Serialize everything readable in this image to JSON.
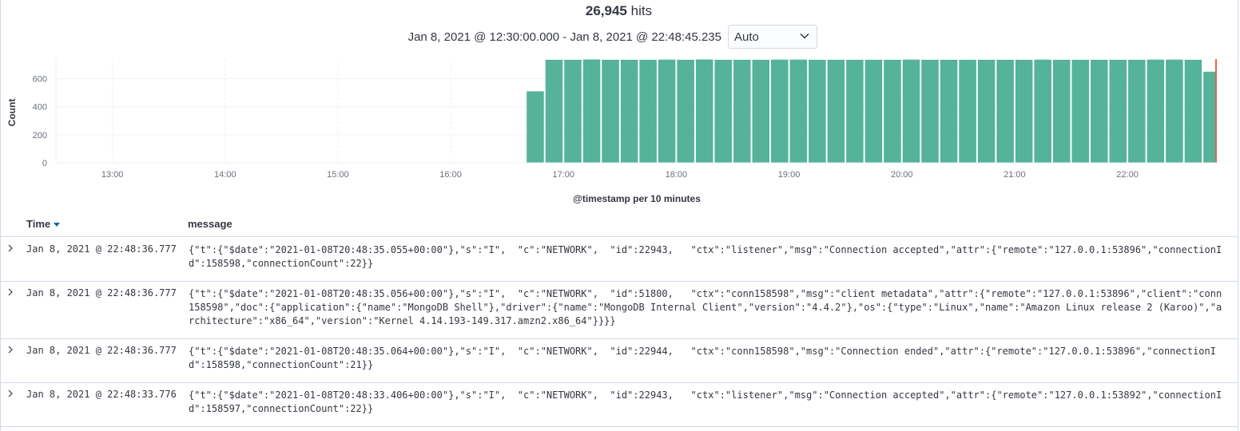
{
  "summary": {
    "hits_count": "26,945",
    "hits_label": "hits"
  },
  "time_range": {
    "text": "Jan 8, 2021 @ 12:30:00.000 - Jan 8, 2021 @ 22:48:45.235"
  },
  "interval": {
    "selected": "Auto"
  },
  "chart_data": {
    "type": "bar",
    "ylabel": "Count",
    "xlabel": "@timestamp per 10 minutes",
    "ylim": [
      0,
      740
    ],
    "yticks": [
      0,
      200,
      400,
      600
    ],
    "xticks": [
      "13:00",
      "14:00",
      "15:00",
      "16:00",
      "17:00",
      "18:00",
      "19:00",
      "20:00",
      "21:00",
      "22:00"
    ],
    "x_start": "12:30",
    "x_end": "22:48",
    "bars": [
      {
        "start": "16:40",
        "value": 510
      },
      {
        "start": "16:50",
        "value": 735
      },
      {
        "start": "17:00",
        "value": 735
      },
      {
        "start": "17:10",
        "value": 737
      },
      {
        "start": "17:20",
        "value": 735
      },
      {
        "start": "17:30",
        "value": 735
      },
      {
        "start": "17:40",
        "value": 735
      },
      {
        "start": "17:50",
        "value": 736
      },
      {
        "start": "18:00",
        "value": 735
      },
      {
        "start": "18:10",
        "value": 737
      },
      {
        "start": "18:20",
        "value": 735
      },
      {
        "start": "18:30",
        "value": 735
      },
      {
        "start": "18:40",
        "value": 735
      },
      {
        "start": "18:50",
        "value": 736
      },
      {
        "start": "19:00",
        "value": 736
      },
      {
        "start": "19:10",
        "value": 735
      },
      {
        "start": "19:20",
        "value": 735
      },
      {
        "start": "19:30",
        "value": 735
      },
      {
        "start": "19:40",
        "value": 735
      },
      {
        "start": "19:50",
        "value": 735
      },
      {
        "start": "20:00",
        "value": 736
      },
      {
        "start": "20:10",
        "value": 735
      },
      {
        "start": "20:20",
        "value": 735
      },
      {
        "start": "20:30",
        "value": 735
      },
      {
        "start": "20:40",
        "value": 735
      },
      {
        "start": "20:50",
        "value": 735
      },
      {
        "start": "21:00",
        "value": 735
      },
      {
        "start": "21:10",
        "value": 736
      },
      {
        "start": "21:20",
        "value": 735
      },
      {
        "start": "21:30",
        "value": 735
      },
      {
        "start": "21:40",
        "value": 735
      },
      {
        "start": "21:50",
        "value": 735
      },
      {
        "start": "22:00",
        "value": 735
      },
      {
        "start": "22:10",
        "value": 736
      },
      {
        "start": "22:20",
        "value": 736
      },
      {
        "start": "22:30",
        "value": 735
      },
      {
        "start": "22:40",
        "value": 650
      }
    ],
    "bar_color": "#54b399",
    "now_marker_color": "#e7664c",
    "grid": true
  },
  "table": {
    "columns": {
      "time": "Time",
      "message": "message"
    },
    "rows": [
      {
        "time": "Jan 8, 2021 @ 22:48:36.777",
        "message": "{\"t\":{\"$date\":\"2021-01-08T20:48:35.055+00:00\"},\"s\":\"I\",  \"c\":\"NETWORK\",  \"id\":22943,   \"ctx\":\"listener\",\"msg\":\"Connection accepted\",\"attr\":{\"remote\":\"127.0.0.1:53896\",\"connectionId\":158598,\"connectionCount\":22}}"
      },
      {
        "time": "Jan 8, 2021 @ 22:48:36.777",
        "message": "{\"t\":{\"$date\":\"2021-01-08T20:48:35.056+00:00\"},\"s\":\"I\",  \"c\":\"NETWORK\",  \"id\":51800,   \"ctx\":\"conn158598\",\"msg\":\"client metadata\",\"attr\":{\"remote\":\"127.0.0.1:53896\",\"client\":\"conn158598\",\"doc\":{\"application\":{\"name\":\"MongoDB Shell\"},\"driver\":{\"name\":\"MongoDB Internal Client\",\"version\":\"4.4.2\"},\"os\":{\"type\":\"Linux\",\"name\":\"Amazon Linux release 2 (Karoo)\",\"architecture\":\"x86_64\",\"version\":\"Kernel 4.14.193-149.317.amzn2.x86_64\"}}}}"
      },
      {
        "time": "Jan 8, 2021 @ 22:48:36.777",
        "message": "{\"t\":{\"$date\":\"2021-01-08T20:48:35.064+00:00\"},\"s\":\"I\",  \"c\":\"NETWORK\",  \"id\":22944,   \"ctx\":\"conn158598\",\"msg\":\"Connection ended\",\"attr\":{\"remote\":\"127.0.0.1:53896\",\"connectionId\":158598,\"connectionCount\":21}}"
      },
      {
        "time": "Jan 8, 2021 @ 22:48:33.776",
        "message": "{\"t\":{\"$date\":\"2021-01-08T20:48:33.406+00:00\"},\"s\":\"I\",  \"c\":\"NETWORK\",  \"id\":22943,   \"ctx\":\"listener\",\"msg\":\"Connection accepted\",\"attr\":{\"remote\":\"127.0.0.1:53892\",\"connectionId\":158597,\"connectionCount\":22}}"
      }
    ]
  }
}
